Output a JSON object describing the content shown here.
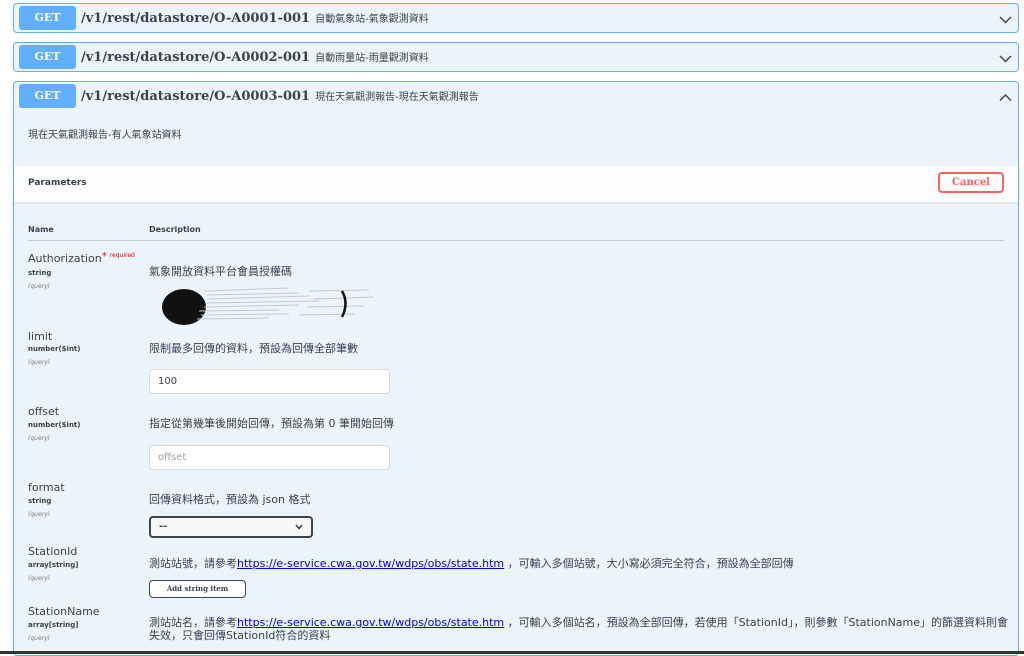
{
  "endpoints": [
    {
      "method": "GET",
      "path": "/v1/rest/datastore/O-A0001-001",
      "summary": "自動氣象站-氣象觀測資料"
    },
    {
      "method": "GET",
      "path": "/v1/rest/datastore/O-A0002-001",
      "summary": "自動雨量站-雨量觀測資料"
    },
    {
      "method": "GET",
      "path": "/v1/rest/datastore/O-A0003-001",
      "summary": "現在天氣觀測報告-現在天氣觀測報告"
    }
  ],
  "expanded": {
    "description": "現在天氣觀測報告-有人氣象站資料",
    "parameters_title": "Parameters",
    "cancel_label": "Cancel",
    "col_name": "Name",
    "col_description": "Description"
  },
  "params": {
    "authorization": {
      "name": "Authorization",
      "required_star": "*",
      "required_label": "required",
      "type": "string",
      "in": "(query)",
      "description": "氣象開放資料平台會員授權碼"
    },
    "limit": {
      "name": "limit",
      "type": "number($int)",
      "in": "(query)",
      "description": "限制最多回傳的資料，預設為回傳全部筆數",
      "value": "100"
    },
    "offset": {
      "name": "offset",
      "type": "number($int)",
      "in": "(query)",
      "description": "指定從第幾筆後開始回傳，預設為第 0 筆開始回傳",
      "placeholder": "offset"
    },
    "format": {
      "name": "format",
      "type": "string",
      "in": "(query)",
      "description": "回傳資料格式，預設為 json 格式",
      "selected": "--"
    },
    "stationid": {
      "name": "StationId",
      "type": "array[string]",
      "in": "(query)",
      "desc_before": "測站站號，請參考",
      "link": "https://e-service.cwa.gov.tw/wdps/obs/state.htm",
      "desc_after": " ，可輸入多個站號，大小寫必須完全符合，預設為全部回傳",
      "add_label": "Add string item"
    },
    "stationname": {
      "name": "StationName",
      "type": "array[string]",
      "in": "(query)",
      "desc_before": "測站站名，請參考",
      "link": "https://e-service.cwa.gov.tw/wdps/obs/state.htm",
      "desc_after": " ，可輸入多個站名，預設為全部回傳，若使用「StationId」，則參數「StationName」的篩選資料則會失效，只會回傳StationId符合的資料"
    }
  },
  "colors": {
    "get": "#61affe",
    "border": "#61affe",
    "background": "#ebf3fb",
    "cancel": "#ff6060",
    "required": "#ff0000"
  },
  "icons": {
    "collapsed": "chevron-down-icon",
    "expanded": "chevron-up-icon",
    "select": "chevron-down-icon"
  }
}
